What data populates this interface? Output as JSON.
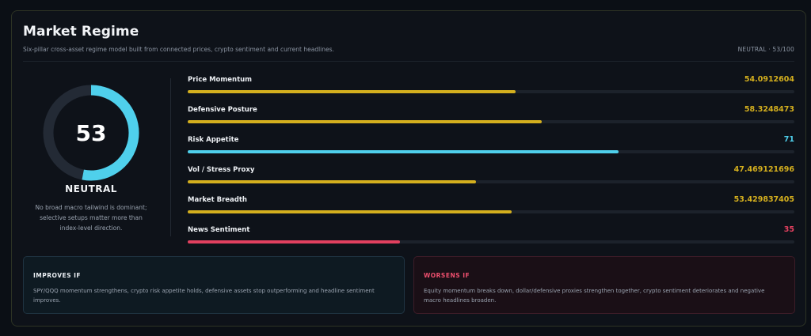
{
  "header": {
    "title": "Market Regime",
    "subtitle": "Six-pillar cross-asset regime model built from connected prices, crypto sentiment and current headlines.",
    "summary": "NEUTRAL · 53/100"
  },
  "gauge": {
    "value": "53",
    "score": 53,
    "max": 100,
    "label": "NEUTRAL",
    "description": "No broad macro tailwind is dominant; selective setups matter more than index-level direction.",
    "color": "#4fd0ec"
  },
  "pillars": [
    {
      "name": "Price Momentum",
      "value": "54.0912604",
      "score": 54.0912604,
      "color": "#d4af1e"
    },
    {
      "name": "Defensive Posture",
      "value": "58.3248473",
      "score": 58.3248473,
      "color": "#d4af1e"
    },
    {
      "name": "Risk Appetite",
      "value": "71",
      "score": 71,
      "color": "#4fd0ec"
    },
    {
      "name": "Vol / Stress Proxy",
      "value": "47.469121696",
      "score": 47.469121696,
      "color": "#d4af1e"
    },
    {
      "name": "Market Breadth",
      "value": "53.429837405",
      "score": 53.429837405,
      "color": "#d4af1e"
    },
    {
      "name": "News Sentiment",
      "value": "35",
      "score": 35,
      "color": "#e2405f"
    }
  ],
  "improves": {
    "title": "IMPROVES IF",
    "text": "SPY/QQQ momentum strengthens, crypto risk appetite holds, defensive assets stop outperforming and headline sentiment improves.",
    "color": "#e9edf2"
  },
  "worsens": {
    "title": "WORSENS IF",
    "text": "Equity momentum breaks down, dollar/defensive proxies strengthen together, crypto sentiment deteriorates and negative macro headlines broaden.",
    "color": "#ee4f6e"
  }
}
